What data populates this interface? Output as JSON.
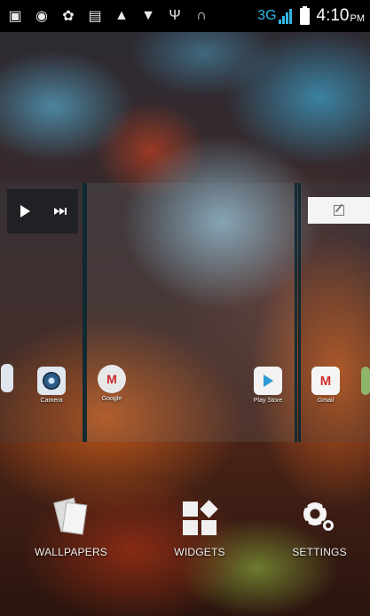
{
  "status_bar": {
    "icons": [
      "notification-icon",
      "voicemail-icon",
      "app-icon",
      "sim-icon",
      "warning-icon",
      "wifi-icon",
      "usb-icon",
      "headset-icon"
    ],
    "network_type": "3G",
    "time": "4:10",
    "ampm": "PM"
  },
  "pages": {
    "music_widget": {
      "play_icon": "play-icon",
      "next_icon": "next-icon"
    },
    "note_widget": {
      "icon": "edit-note-icon"
    }
  },
  "apps": [
    {
      "label": "Camera"
    },
    {
      "label": "Google"
    },
    {
      "label": "Play Store"
    },
    {
      "label": "Gmail"
    }
  ],
  "options": [
    {
      "label": "WALLPAPERS"
    },
    {
      "label": "WIDGETS"
    },
    {
      "label": "SETTINGS"
    }
  ]
}
